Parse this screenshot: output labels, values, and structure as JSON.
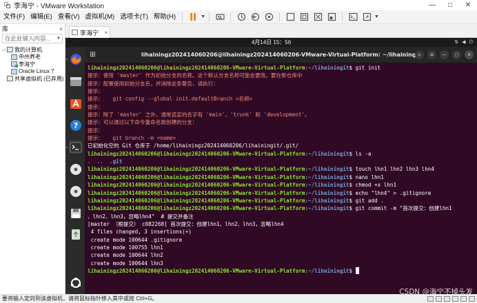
{
  "window": {
    "title": "李海宁 - VMware Workstation",
    "controls": {
      "minimize": "—",
      "maximize": "□",
      "close": "✕"
    }
  },
  "menubar": {
    "items": [
      "文件(F)",
      "编辑(E)",
      "查看(V)",
      "虚拟机(M)",
      "选项卡(T)",
      "帮助(H)"
    ],
    "toolbar_icons": [
      "pause-icon",
      "send-keys-icon",
      "snapshot-icon",
      "revert-snapshot-icon",
      "snapshot-manager-icon",
      "fullscreen-icon",
      "unity-icon",
      "stretch-icon",
      "console-view-icon",
      "autofit-icon"
    ]
  },
  "library": {
    "title": "库",
    "close": "×",
    "search_placeholder": "在此处键入内容...",
    "tree": [
      {
        "label": "我的计算机",
        "level": 0,
        "icon": "computer-icon",
        "expander": "▭"
      },
      {
        "label": "中州养老",
        "level": 1,
        "icon": "vm-icon"
      },
      {
        "label": "李海宁",
        "level": 1,
        "icon": "vm-running-icon"
      },
      {
        "label": "Oracle Linux 7",
        "level": 1,
        "icon": "vm-icon"
      },
      {
        "label": "共享虚拟机 (已弃用)",
        "level": 0,
        "icon": "shared-vm-icon"
      }
    ]
  },
  "vm_tab": {
    "label": "李海宁",
    "close": "×"
  },
  "guest": {
    "clock": "4月14日  15：56",
    "terminal_title": "lihainingz202414060206@lihainingz202414060206-VMware-Virtual-Platform: ~/lihainingit",
    "dock_icons": [
      "firefox-icon",
      "files-icon",
      "app-center-icon",
      "help-icon",
      "terminal-icon",
      "disc-icon",
      "disc-icon",
      "save-disk-icon",
      "trash-icon",
      "ubuntu-logo-icon"
    ]
  },
  "terminal": {
    "prompt_user": "lihainingz202414060206@lihainingz202414060206-VMware-Virtual-Platform",
    "prompt_path": ":~/lihainingit",
    "lines": [
      {
        "type": "cmd",
        "cmd": "git init"
      },
      {
        "type": "hint",
        "text": "提示：使用 'master' 作为初始分支的名称。这个默认分支名称可能会更改。要在新仓库中"
      },
      {
        "type": "hint",
        "text": "提示：配置使用初始分支名，并消除这条警告，请执行："
      },
      {
        "type": "hint",
        "text": "提示："
      },
      {
        "type": "hint",
        "text": "提示：   git config --global init.defaultBranch <名称>"
      },
      {
        "type": "hint",
        "text": "提示："
      },
      {
        "type": "hint",
        "text": "提示：除了 'master' 之外，通常选定的名字有 'main'、'trunk' 和 'development'。"
      },
      {
        "type": "hint",
        "text": "提示：可以通过以下命令重命名刚创建的分支："
      },
      {
        "type": "hint",
        "text": "提示："
      },
      {
        "type": "hint",
        "text": "提示：   git branch -m <name>"
      },
      {
        "type": "out",
        "text": "已初始化空的 Git 仓库于 /home/lihainingz202414060206/lihainingit/.git/"
      },
      {
        "type": "cmd",
        "cmd": "ls -a"
      },
      {
        "type": "dir",
        "text": ".  ..  .git"
      },
      {
        "type": "cmd",
        "cmd": "touch lhn1 lhn2 lhn3 lhn4"
      },
      {
        "type": "cmd",
        "cmd": "nano lhn1"
      },
      {
        "type": "cmd",
        "cmd": "chmod +x lhn1"
      },
      {
        "type": "cmd",
        "cmd": "echo \"lhn4\" > .gitignore"
      },
      {
        "type": "cmd",
        "cmd": "git add ."
      },
      {
        "type": "cmd",
        "cmd": "git commit -m \"首次提交：创建lhn1"
      },
      {
        "type": "out",
        "text": "、lhn2、lhn3，忽略lhn4\"  # 提交并备注"
      },
      {
        "type": "out",
        "text": "[master （根提交） c082268] 首次提交：创建lhn1、lhn2、lhn3，忽略lhn4"
      },
      {
        "type": "out",
        "text": " 4 files changed, 3 insertions(+)"
      },
      {
        "type": "out",
        "text": " create mode 100644 .gitignore"
      },
      {
        "type": "out",
        "text": " create mode 100755 lhn1"
      },
      {
        "type": "out",
        "text": " create mode 100644 lhn2"
      },
      {
        "type": "out",
        "text": " create mode 100644 lhn3"
      },
      {
        "type": "prompt_cursor"
      }
    ]
  },
  "statusbar": {
    "text": "要将输入定向到该虚拟机，请将鼠标指针移入其中或按 Ctrl+G。"
  },
  "watermark": "CSDN @海宁不掉头发",
  "colors": {
    "terminal_bg": "#300a24",
    "prompt_user": "#8ae234",
    "prompt_path": "#729fcf",
    "hint_text": "#f28c7c",
    "pause_accent": "#f08a18"
  }
}
